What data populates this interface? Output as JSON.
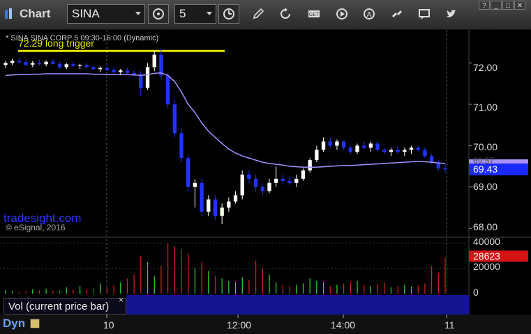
{
  "app": {
    "title": "Chart"
  },
  "toolbar": {
    "symbol": "SINA",
    "interval": "5",
    "icons": [
      "settings-gear-icon",
      "clock-icon",
      "pencil-icon",
      "refresh-icon",
      "get-icon",
      "play-icon",
      "alert-icon",
      "link-icon",
      "comment-icon",
      "twitter-icon"
    ]
  },
  "window": {
    "help": "?",
    "minimize": "_",
    "maximize": "□",
    "close": "✕"
  },
  "chart_data": {
    "type": "candlestick",
    "title": "* SINA  SINA CORP  5  09:30-16:00 (Dynamic)",
    "annotation": "72.29 long trigger",
    "trigger_level": 72.29,
    "watermark": "tradesight.com",
    "copyright": "© eSignal, 2016",
    "y_ticks": [
      "72.00",
      "71.00",
      "70.00",
      "69.00",
      "68.00"
    ],
    "ylim": [
      67.8,
      72.8
    ],
    "x_ticks": [
      "10",
      "12:00",
      "14:00",
      "11"
    ],
    "last_price": "69.43",
    "ma_value": "69.57",
    "ma_color": "#a890ff",
    "up_color": "#ffffff",
    "down_color": "#2233ff",
    "candles": [
      [
        71.95,
        72.05,
        71.88,
        72.0
      ],
      [
        72.0,
        72.1,
        71.95,
        72.05
      ],
      [
        72.05,
        72.12,
        71.98,
        72.02
      ],
      [
        72.02,
        72.08,
        71.92,
        71.96
      ],
      [
        71.96,
        72.05,
        71.9,
        72.0
      ],
      [
        72.0,
        72.08,
        71.94,
        71.97
      ],
      [
        71.97,
        72.06,
        71.92,
        72.03
      ],
      [
        72.03,
        72.1,
        71.96,
        71.98
      ],
      [
        71.98,
        72.03,
        71.85,
        71.9
      ],
      [
        71.9,
        72.0,
        71.85,
        71.97
      ],
      [
        71.97,
        72.03,
        71.9,
        71.93
      ],
      [
        71.93,
        71.98,
        71.86,
        71.95
      ],
      [
        71.95,
        72.0,
        71.88,
        71.9
      ],
      [
        71.9,
        71.95,
        71.82,
        71.85
      ],
      [
        71.85,
        71.92,
        71.78,
        71.88
      ],
      [
        71.88,
        71.93,
        71.8,
        71.83
      ],
      [
        71.83,
        71.9,
        71.75,
        71.78
      ],
      [
        71.78,
        71.86,
        71.7,
        71.82
      ],
      [
        71.82,
        71.88,
        71.74,
        71.76
      ],
      [
        71.76,
        71.82,
        71.68,
        71.72
      ],
      [
        71.72,
        71.8,
        71.2,
        71.4
      ],
      [
        71.4,
        72.0,
        71.35,
        71.9
      ],
      [
        71.9,
        72.3,
        71.8,
        72.2
      ],
      [
        72.2,
        72.35,
        71.6,
        71.7
      ],
      [
        71.7,
        71.75,
        70.9,
        71.0
      ],
      [
        71.0,
        71.1,
        70.2,
        70.3
      ],
      [
        70.3,
        70.4,
        69.6,
        69.7
      ],
      [
        69.7,
        69.8,
        68.9,
        69.0
      ],
      [
        69.0,
        69.2,
        68.5,
        69.1
      ],
      [
        69.1,
        69.2,
        68.3,
        68.4
      ],
      [
        68.4,
        68.8,
        68.3,
        68.7
      ],
      [
        68.7,
        68.8,
        68.2,
        68.3
      ],
      [
        68.3,
        68.6,
        68.1,
        68.5
      ],
      [
        68.5,
        68.75,
        68.4,
        68.65
      ],
      [
        68.65,
        68.9,
        68.6,
        68.8
      ],
      [
        68.8,
        69.4,
        68.7,
        69.3
      ],
      [
        69.3,
        69.4,
        69.1,
        69.2
      ],
      [
        69.2,
        69.3,
        68.9,
        69.0
      ],
      [
        69.0,
        69.05,
        68.8,
        68.9
      ],
      [
        68.9,
        69.2,
        68.85,
        69.1
      ],
      [
        69.1,
        69.5,
        69.0,
        69.2
      ],
      [
        69.2,
        69.3,
        69.05,
        69.15
      ],
      [
        69.15,
        69.25,
        69.05,
        69.1
      ],
      [
        69.1,
        69.3,
        69.0,
        69.2
      ],
      [
        69.2,
        69.45,
        69.15,
        69.4
      ],
      [
        69.4,
        69.7,
        69.35,
        69.65
      ],
      [
        69.65,
        70.0,
        69.6,
        69.9
      ],
      [
        69.9,
        70.2,
        69.85,
        70.1
      ],
      [
        70.1,
        70.2,
        69.95,
        70.0
      ],
      [
        70.0,
        70.15,
        69.9,
        70.1
      ],
      [
        70.1,
        70.12,
        69.9,
        69.95
      ],
      [
        69.95,
        70.0,
        69.8,
        69.85
      ],
      [
        69.85,
        70.05,
        69.8,
        70.0
      ],
      [
        70.0,
        70.1,
        69.9,
        69.95
      ],
      [
        69.95,
        70.1,
        69.85,
        70.05
      ],
      [
        70.05,
        70.1,
        69.85,
        69.9
      ],
      [
        69.9,
        69.95,
        69.8,
        69.85
      ],
      [
        69.85,
        69.95,
        69.75,
        69.9
      ],
      [
        69.9,
        70.0,
        69.8,
        69.85
      ],
      [
        69.85,
        69.95,
        69.75,
        69.9
      ],
      [
        69.9,
        70.0,
        69.8,
        69.95
      ],
      [
        69.95,
        70.0,
        69.85,
        69.9
      ],
      [
        69.9,
        69.95,
        69.7,
        69.75
      ],
      [
        69.75,
        69.8,
        69.55,
        69.6
      ],
      [
        69.6,
        69.65,
        69.4,
        69.45
      ],
      [
        69.45,
        69.55,
        69.35,
        69.43
      ]
    ],
    "ma": [
      71.7,
      71.71,
      71.72,
      71.72,
      71.73,
      71.73,
      71.74,
      71.74,
      71.74,
      71.74,
      71.74,
      71.74,
      71.74,
      71.73,
      71.73,
      71.72,
      71.72,
      71.72,
      71.72,
      71.71,
      71.7,
      71.72,
      71.75,
      71.76,
      71.7,
      71.55,
      71.3,
      71.0,
      70.8,
      70.55,
      70.35,
      70.2,
      70.05,
      69.92,
      69.82,
      69.75,
      69.7,
      69.65,
      69.6,
      69.57,
      69.55,
      69.53,
      69.5,
      69.49,
      69.48,
      69.48,
      69.48,
      69.49,
      69.5,
      69.51,
      69.52,
      69.52,
      69.53,
      69.54,
      69.55,
      69.56,
      69.57,
      69.58,
      69.59,
      69.6,
      69.61,
      69.62,
      69.61,
      69.6,
      69.58,
      69.57
    ],
    "volume_ticks": [
      "40000",
      "20000",
      "0"
    ],
    "volume_ylim": [
      0,
      44000
    ],
    "last_volume": "28623",
    "volumes": [
      3000,
      2000,
      1500,
      1800,
      3500,
      2500,
      4000,
      2200,
      2800,
      5000,
      3000,
      6000,
      3500,
      4200,
      8000,
      5000,
      6500,
      9000,
      12000,
      15000,
      30000,
      25000,
      14000,
      22000,
      40000,
      38000,
      35000,
      32000,
      20000,
      25000,
      18000,
      14000,
      12000,
      10000,
      9000,
      13000,
      11000,
      26000,
      20000,
      15000,
      9000,
      7000,
      6000,
      7000,
      8000,
      12000,
      10000,
      9000,
      6000,
      7000,
      8000,
      9000,
      10000,
      7000,
      6000,
      8000,
      9000,
      5000,
      6000,
      7000,
      5500,
      6500,
      8000,
      22000,
      16000,
      28623
    ],
    "volume_colors_up": "#33dd33",
    "volume_colors_down": "#dd2222"
  },
  "volume_panel": {
    "label": "Vol (current price bar)",
    "close": "×"
  },
  "footer": {
    "mode": "Dyn"
  }
}
